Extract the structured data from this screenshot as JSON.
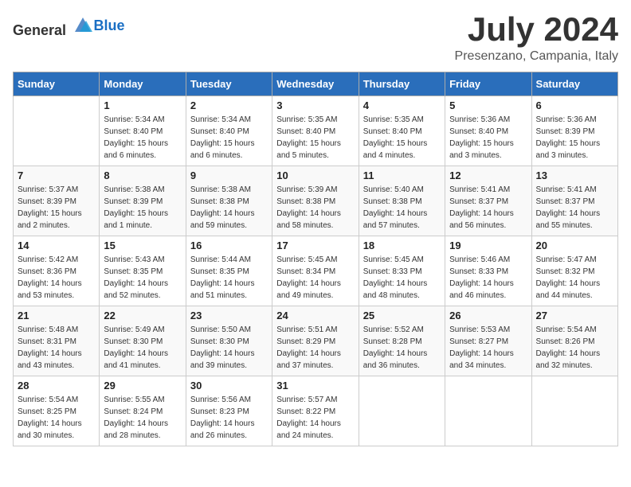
{
  "logo": {
    "general": "General",
    "blue": "Blue"
  },
  "header": {
    "month": "July 2024",
    "location": "Presenzano, Campania, Italy"
  },
  "weekdays": [
    "Sunday",
    "Monday",
    "Tuesday",
    "Wednesday",
    "Thursday",
    "Friday",
    "Saturday"
  ],
  "weeks": [
    [
      {
        "day": "",
        "empty": true
      },
      {
        "day": "1",
        "sunrise": "5:34 AM",
        "sunset": "8:40 PM",
        "daylight": "15 hours and 6 minutes."
      },
      {
        "day": "2",
        "sunrise": "5:34 AM",
        "sunset": "8:40 PM",
        "daylight": "15 hours and 6 minutes."
      },
      {
        "day": "3",
        "sunrise": "5:35 AM",
        "sunset": "8:40 PM",
        "daylight": "15 hours and 5 minutes."
      },
      {
        "day": "4",
        "sunrise": "5:35 AM",
        "sunset": "8:40 PM",
        "daylight": "15 hours and 4 minutes."
      },
      {
        "day": "5",
        "sunrise": "5:36 AM",
        "sunset": "8:40 PM",
        "daylight": "15 hours and 3 minutes."
      },
      {
        "day": "6",
        "sunrise": "5:36 AM",
        "sunset": "8:39 PM",
        "daylight": "15 hours and 3 minutes."
      }
    ],
    [
      {
        "day": "7",
        "sunrise": "5:37 AM",
        "sunset": "8:39 PM",
        "daylight": "15 hours and 2 minutes."
      },
      {
        "day": "8",
        "sunrise": "5:38 AM",
        "sunset": "8:39 PM",
        "daylight": "15 hours and 1 minute."
      },
      {
        "day": "9",
        "sunrise": "5:38 AM",
        "sunset": "8:38 PM",
        "daylight": "14 hours and 59 minutes."
      },
      {
        "day": "10",
        "sunrise": "5:39 AM",
        "sunset": "8:38 PM",
        "daylight": "14 hours and 58 minutes."
      },
      {
        "day": "11",
        "sunrise": "5:40 AM",
        "sunset": "8:38 PM",
        "daylight": "14 hours and 57 minutes."
      },
      {
        "day": "12",
        "sunrise": "5:41 AM",
        "sunset": "8:37 PM",
        "daylight": "14 hours and 56 minutes."
      },
      {
        "day": "13",
        "sunrise": "5:41 AM",
        "sunset": "8:37 PM",
        "daylight": "14 hours and 55 minutes."
      }
    ],
    [
      {
        "day": "14",
        "sunrise": "5:42 AM",
        "sunset": "8:36 PM",
        "daylight": "14 hours and 53 minutes."
      },
      {
        "day": "15",
        "sunrise": "5:43 AM",
        "sunset": "8:35 PM",
        "daylight": "14 hours and 52 minutes."
      },
      {
        "day": "16",
        "sunrise": "5:44 AM",
        "sunset": "8:35 PM",
        "daylight": "14 hours and 51 minutes."
      },
      {
        "day": "17",
        "sunrise": "5:45 AM",
        "sunset": "8:34 PM",
        "daylight": "14 hours and 49 minutes."
      },
      {
        "day": "18",
        "sunrise": "5:45 AM",
        "sunset": "8:33 PM",
        "daylight": "14 hours and 48 minutes."
      },
      {
        "day": "19",
        "sunrise": "5:46 AM",
        "sunset": "8:33 PM",
        "daylight": "14 hours and 46 minutes."
      },
      {
        "day": "20",
        "sunrise": "5:47 AM",
        "sunset": "8:32 PM",
        "daylight": "14 hours and 44 minutes."
      }
    ],
    [
      {
        "day": "21",
        "sunrise": "5:48 AM",
        "sunset": "8:31 PM",
        "daylight": "14 hours and 43 minutes."
      },
      {
        "day": "22",
        "sunrise": "5:49 AM",
        "sunset": "8:30 PM",
        "daylight": "14 hours and 41 minutes."
      },
      {
        "day": "23",
        "sunrise": "5:50 AM",
        "sunset": "8:30 PM",
        "daylight": "14 hours and 39 minutes."
      },
      {
        "day": "24",
        "sunrise": "5:51 AM",
        "sunset": "8:29 PM",
        "daylight": "14 hours and 37 minutes."
      },
      {
        "day": "25",
        "sunrise": "5:52 AM",
        "sunset": "8:28 PM",
        "daylight": "14 hours and 36 minutes."
      },
      {
        "day": "26",
        "sunrise": "5:53 AM",
        "sunset": "8:27 PM",
        "daylight": "14 hours and 34 minutes."
      },
      {
        "day": "27",
        "sunrise": "5:54 AM",
        "sunset": "8:26 PM",
        "daylight": "14 hours and 32 minutes."
      }
    ],
    [
      {
        "day": "28",
        "sunrise": "5:54 AM",
        "sunset": "8:25 PM",
        "daylight": "14 hours and 30 minutes."
      },
      {
        "day": "29",
        "sunrise": "5:55 AM",
        "sunset": "8:24 PM",
        "daylight": "14 hours and 28 minutes."
      },
      {
        "day": "30",
        "sunrise": "5:56 AM",
        "sunset": "8:23 PM",
        "daylight": "14 hours and 26 minutes."
      },
      {
        "day": "31",
        "sunrise": "5:57 AM",
        "sunset": "8:22 PM",
        "daylight": "14 hours and 24 minutes."
      },
      {
        "day": "",
        "empty": true
      },
      {
        "day": "",
        "empty": true
      },
      {
        "day": "",
        "empty": true
      }
    ]
  ],
  "labels": {
    "sunrise_prefix": "Sunrise: ",
    "sunset_prefix": "Sunset: ",
    "daylight_prefix": "Daylight: "
  }
}
